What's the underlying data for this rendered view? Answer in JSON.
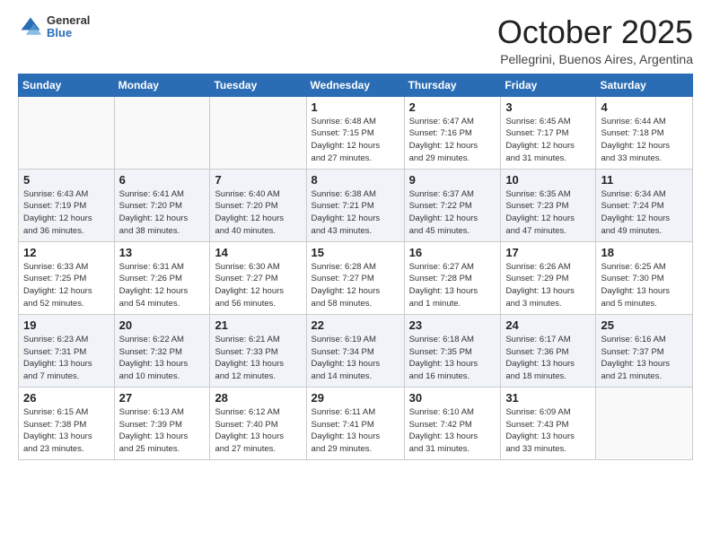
{
  "header": {
    "logo_general": "General",
    "logo_blue": "Blue",
    "month_title": "October 2025",
    "location": "Pellegrini, Buenos Aires, Argentina"
  },
  "days_of_week": [
    "Sunday",
    "Monday",
    "Tuesday",
    "Wednesday",
    "Thursday",
    "Friday",
    "Saturday"
  ],
  "weeks": [
    [
      {
        "day": "",
        "info": ""
      },
      {
        "day": "",
        "info": ""
      },
      {
        "day": "",
        "info": ""
      },
      {
        "day": "1",
        "info": "Sunrise: 6:48 AM\nSunset: 7:15 PM\nDaylight: 12 hours\nand 27 minutes."
      },
      {
        "day": "2",
        "info": "Sunrise: 6:47 AM\nSunset: 7:16 PM\nDaylight: 12 hours\nand 29 minutes."
      },
      {
        "day": "3",
        "info": "Sunrise: 6:45 AM\nSunset: 7:17 PM\nDaylight: 12 hours\nand 31 minutes."
      },
      {
        "day": "4",
        "info": "Sunrise: 6:44 AM\nSunset: 7:18 PM\nDaylight: 12 hours\nand 33 minutes."
      }
    ],
    [
      {
        "day": "5",
        "info": "Sunrise: 6:43 AM\nSunset: 7:19 PM\nDaylight: 12 hours\nand 36 minutes."
      },
      {
        "day": "6",
        "info": "Sunrise: 6:41 AM\nSunset: 7:20 PM\nDaylight: 12 hours\nand 38 minutes."
      },
      {
        "day": "7",
        "info": "Sunrise: 6:40 AM\nSunset: 7:20 PM\nDaylight: 12 hours\nand 40 minutes."
      },
      {
        "day": "8",
        "info": "Sunrise: 6:38 AM\nSunset: 7:21 PM\nDaylight: 12 hours\nand 43 minutes."
      },
      {
        "day": "9",
        "info": "Sunrise: 6:37 AM\nSunset: 7:22 PM\nDaylight: 12 hours\nand 45 minutes."
      },
      {
        "day": "10",
        "info": "Sunrise: 6:35 AM\nSunset: 7:23 PM\nDaylight: 12 hours\nand 47 minutes."
      },
      {
        "day": "11",
        "info": "Sunrise: 6:34 AM\nSunset: 7:24 PM\nDaylight: 12 hours\nand 49 minutes."
      }
    ],
    [
      {
        "day": "12",
        "info": "Sunrise: 6:33 AM\nSunset: 7:25 PM\nDaylight: 12 hours\nand 52 minutes."
      },
      {
        "day": "13",
        "info": "Sunrise: 6:31 AM\nSunset: 7:26 PM\nDaylight: 12 hours\nand 54 minutes."
      },
      {
        "day": "14",
        "info": "Sunrise: 6:30 AM\nSunset: 7:27 PM\nDaylight: 12 hours\nand 56 minutes."
      },
      {
        "day": "15",
        "info": "Sunrise: 6:28 AM\nSunset: 7:27 PM\nDaylight: 12 hours\nand 58 minutes."
      },
      {
        "day": "16",
        "info": "Sunrise: 6:27 AM\nSunset: 7:28 PM\nDaylight: 13 hours\nand 1 minute."
      },
      {
        "day": "17",
        "info": "Sunrise: 6:26 AM\nSunset: 7:29 PM\nDaylight: 13 hours\nand 3 minutes."
      },
      {
        "day": "18",
        "info": "Sunrise: 6:25 AM\nSunset: 7:30 PM\nDaylight: 13 hours\nand 5 minutes."
      }
    ],
    [
      {
        "day": "19",
        "info": "Sunrise: 6:23 AM\nSunset: 7:31 PM\nDaylight: 13 hours\nand 7 minutes."
      },
      {
        "day": "20",
        "info": "Sunrise: 6:22 AM\nSunset: 7:32 PM\nDaylight: 13 hours\nand 10 minutes."
      },
      {
        "day": "21",
        "info": "Sunrise: 6:21 AM\nSunset: 7:33 PM\nDaylight: 13 hours\nand 12 minutes."
      },
      {
        "day": "22",
        "info": "Sunrise: 6:19 AM\nSunset: 7:34 PM\nDaylight: 13 hours\nand 14 minutes."
      },
      {
        "day": "23",
        "info": "Sunrise: 6:18 AM\nSunset: 7:35 PM\nDaylight: 13 hours\nand 16 minutes."
      },
      {
        "day": "24",
        "info": "Sunrise: 6:17 AM\nSunset: 7:36 PM\nDaylight: 13 hours\nand 18 minutes."
      },
      {
        "day": "25",
        "info": "Sunrise: 6:16 AM\nSunset: 7:37 PM\nDaylight: 13 hours\nand 21 minutes."
      }
    ],
    [
      {
        "day": "26",
        "info": "Sunrise: 6:15 AM\nSunset: 7:38 PM\nDaylight: 13 hours\nand 23 minutes."
      },
      {
        "day": "27",
        "info": "Sunrise: 6:13 AM\nSunset: 7:39 PM\nDaylight: 13 hours\nand 25 minutes."
      },
      {
        "day": "28",
        "info": "Sunrise: 6:12 AM\nSunset: 7:40 PM\nDaylight: 13 hours\nand 27 minutes."
      },
      {
        "day": "29",
        "info": "Sunrise: 6:11 AM\nSunset: 7:41 PM\nDaylight: 13 hours\nand 29 minutes."
      },
      {
        "day": "30",
        "info": "Sunrise: 6:10 AM\nSunset: 7:42 PM\nDaylight: 13 hours\nand 31 minutes."
      },
      {
        "day": "31",
        "info": "Sunrise: 6:09 AM\nSunset: 7:43 PM\nDaylight: 13 hours\nand 33 minutes."
      },
      {
        "day": "",
        "info": ""
      }
    ]
  ]
}
